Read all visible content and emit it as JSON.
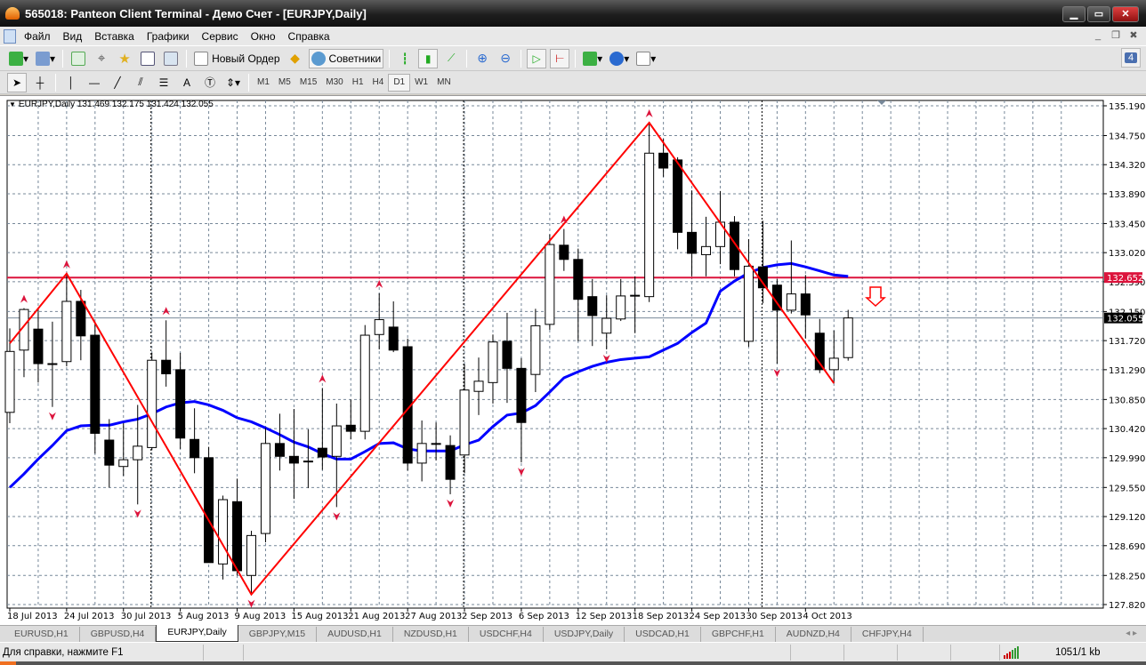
{
  "window": {
    "title": "565018: Panteon Client Terminal - Демо Счет - [EURJPY,Daily]"
  },
  "menu": [
    "Файл",
    "Вид",
    "Вставка",
    "Графики",
    "Сервис",
    "Окно",
    "Справка"
  ],
  "toolbar": {
    "new_order": "Новый Ордер",
    "experts": "Советники",
    "notifications_count": "4"
  },
  "timeframes": [
    "M1",
    "M5",
    "M15",
    "M30",
    "H1",
    "H4",
    "D1",
    "W1",
    "MN"
  ],
  "active_timeframe": "D1",
  "chart": {
    "header": "EURJPY,Daily  131.469 132.175 131.424 132.055",
    "symbol": "EURJPY",
    "period": "Daily"
  },
  "chart_data": {
    "type": "candlestick",
    "symbol": "EURJPY",
    "timeframe": "Daily",
    "ylim": [
      127.82,
      135.19
    ],
    "y_ticks": [
      "135.190",
      "134.750",
      "134.320",
      "133.890",
      "133.450",
      "133.020",
      "132.590",
      "132.150",
      "131.720",
      "131.290",
      "130.850",
      "130.420",
      "129.990",
      "129.550",
      "129.120",
      "128.690",
      "128.250",
      "127.820"
    ],
    "x_tick_labels": [
      "18 Jul 2013",
      "24 Jul 2013",
      "30 Jul 2013",
      "5 Aug 2013",
      "9 Aug 2013",
      "15 Aug 2013",
      "21 Aug 2013",
      "27 Aug 2013",
      "2 Sep 2013",
      "6 Sep 2013",
      "12 Sep 2013",
      "18 Sep 2013",
      "24 Sep 2013",
      "30 Sep 2013",
      "4 Oct 2013"
    ],
    "x_tick_every_bars": 4,
    "grid": true,
    "ohlc": [
      [
        130.66,
        131.9,
        130.5,
        131.56
      ],
      [
        131.58,
        132.2,
        131.18,
        132.18
      ],
      [
        131.89,
        132.2,
        131.1,
        131.38
      ],
      [
        131.38,
        132.0,
        130.74,
        131.38
      ],
      [
        131.41,
        132.71,
        131.34,
        132.3
      ],
      [
        132.3,
        132.47,
        131.43,
        131.79
      ],
      [
        131.8,
        131.98,
        130.05,
        130.35
      ],
      [
        130.25,
        130.56,
        129.55,
        129.88
      ],
      [
        129.86,
        130.5,
        129.72,
        129.96
      ],
      [
        129.96,
        130.77,
        129.3,
        130.16
      ],
      [
        130.14,
        131.54,
        130.1,
        131.43
      ],
      [
        131.43,
        132.02,
        131.04,
        131.23
      ],
      [
        131.29,
        131.54,
        130.12,
        130.28
      ],
      [
        130.26,
        130.72,
        129.76,
        129.99
      ],
      [
        129.99,
        130.15,
        128.44,
        128.44
      ],
      [
        128.42,
        129.43,
        128.19,
        129.37
      ],
      [
        129.34,
        129.68,
        128.25,
        128.32
      ],
      [
        128.25,
        128.91,
        127.97,
        128.84
      ],
      [
        128.87,
        130.43,
        128.74,
        130.2
      ],
      [
        130.2,
        130.64,
        129.8,
        130.01
      ],
      [
        130.01,
        130.71,
        129.38,
        129.91
      ],
      [
        129.93,
        130.41,
        129.54,
        129.94
      ],
      [
        130.13,
        131.02,
        129.81,
        130.0
      ],
      [
        130.01,
        130.79,
        129.26,
        130.46
      ],
      [
        130.47,
        130.85,
        130.26,
        130.38
      ],
      [
        130.38,
        131.95,
        130.26,
        131.8
      ],
      [
        131.81,
        132.42,
        131.59,
        132.03
      ],
      [
        131.92,
        132.3,
        131.55,
        131.58
      ],
      [
        131.63,
        131.75,
        129.8,
        129.91
      ],
      [
        129.91,
        130.54,
        129.64,
        130.2
      ],
      [
        130.2,
        130.51,
        129.95,
        130.19
      ],
      [
        130.17,
        130.32,
        129.45,
        129.67
      ],
      [
        130.03,
        131.37,
        129.76,
        130.99
      ],
      [
        130.97,
        131.47,
        130.62,
        131.12
      ],
      [
        131.1,
        131.81,
        130.79,
        131.7
      ],
      [
        131.71,
        132.13,
        130.8,
        131.31
      ],
      [
        131.31,
        131.46,
        129.92,
        130.51
      ],
      [
        131.22,
        132.19,
        130.96,
        131.94
      ],
      [
        131.96,
        133.29,
        131.88,
        133.14
      ],
      [
        133.13,
        133.37,
        132.75,
        132.92
      ],
      [
        132.92,
        133.08,
        131.71,
        132.33
      ],
      [
        132.37,
        132.63,
        131.64,
        132.09
      ],
      [
        131.83,
        132.39,
        131.59,
        132.05
      ],
      [
        132.04,
        132.63,
        132.01,
        132.38
      ],
      [
        132.39,
        132.67,
        131.83,
        132.38
      ],
      [
        132.37,
        134.94,
        132.29,
        134.49
      ],
      [
        134.49,
        134.7,
        134.14,
        134.27
      ],
      [
        134.39,
        134.43,
        133.07,
        133.32
      ],
      [
        133.32,
        133.94,
        132.67,
        133.01
      ],
      [
        132.99,
        133.55,
        132.67,
        133.11
      ],
      [
        133.11,
        133.93,
        132.85,
        133.47
      ],
      [
        133.47,
        133.56,
        132.67,
        132.77
      ],
      [
        131.71,
        133.22,
        131.63,
        132.82
      ],
      [
        132.81,
        133.49,
        132.27,
        132.5
      ],
      [
        132.54,
        132.63,
        131.38,
        132.17
      ],
      [
        132.17,
        133.2,
        132.12,
        132.41
      ],
      [
        132.41,
        132.69,
        131.75,
        132.1
      ],
      [
        131.83,
        132.04,
        131.24,
        131.29
      ],
      [
        131.29,
        131.87,
        131.09,
        131.46
      ],
      [
        131.469,
        132.175,
        131.424,
        132.055
      ]
    ],
    "moving_average": {
      "color": "#0000ff",
      "values": [
        129.55,
        129.75,
        129.97,
        130.17,
        130.39,
        130.46,
        130.47,
        130.47,
        130.52,
        130.56,
        130.64,
        130.74,
        130.8,
        130.82,
        130.77,
        130.69,
        130.58,
        130.52,
        130.43,
        130.33,
        130.22,
        130.15,
        130.05,
        129.97,
        129.97,
        130.08,
        130.2,
        130.21,
        130.12,
        130.09,
        130.09,
        130.09,
        130.18,
        130.25,
        130.45,
        130.62,
        130.65,
        130.76,
        130.96,
        131.17,
        131.26,
        131.34,
        131.4,
        131.44,
        131.46,
        131.48,
        131.58,
        131.68,
        131.84,
        131.98,
        132.45,
        132.6,
        132.72,
        132.8,
        132.84,
        132.86,
        132.81,
        132.75,
        132.69,
        132.67
      ]
    },
    "zigzag": {
      "color": "#ff0000",
      "points": [
        [
          0,
          131.68
        ],
        [
          4,
          132.71
        ],
        [
          17,
          127.97
        ],
        [
          45,
          134.94
        ],
        [
          58,
          131.09
        ]
      ]
    },
    "fractals_up": [
      1,
      4,
      11,
      22,
      26,
      39,
      45
    ],
    "fractals_down": [
      3,
      9,
      17,
      23,
      31,
      36,
      42,
      54
    ],
    "period_separators": [
      10,
      32,
      53
    ],
    "horizontal_line": {
      "price": "132.652",
      "color": "#dc143c"
    },
    "bid_line": {
      "price": "132.055"
    },
    "signal_marker": {
      "type": "sell-arrow",
      "color": "#ff0000"
    }
  },
  "tabs": [
    "EURUSD,H1",
    "GBPUSD,H4",
    "EURJPY,Daily",
    "GBPJPY,M15",
    "AUDUSD,H1",
    "NZDUSD,H1",
    "USDCHF,H4",
    "USDJPY,Daily",
    "USDCAD,H1",
    "GBPCHF,H1",
    "AUDNZD,H4",
    "CHFJPY,H4"
  ],
  "active_tab": "EURJPY,Daily",
  "status": {
    "help": "Для справки, нажмите F1",
    "traffic": "1051/1 kb"
  }
}
